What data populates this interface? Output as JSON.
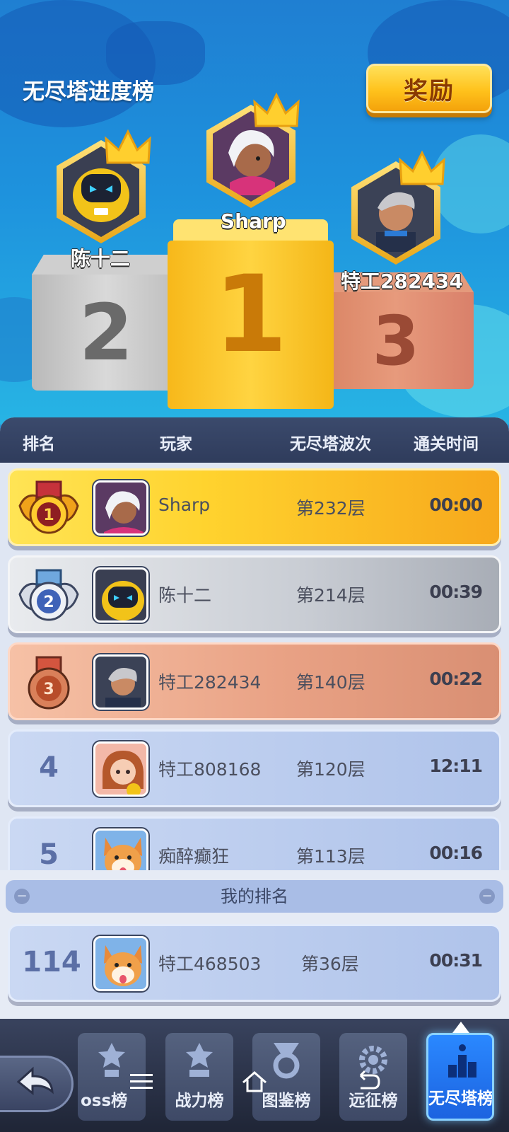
{
  "header": {
    "title": "无尽塔进度榜",
    "reward_label": "奖励"
  },
  "podium": [
    {
      "place": "2",
      "name": "陈十二"
    },
    {
      "place": "1",
      "name": "Sharp"
    },
    {
      "place": "3",
      "name": "特工282434"
    }
  ],
  "table": {
    "columns": [
      "排名",
      "玩家",
      "无尽塔波次",
      "通关时间"
    ],
    "rows": [
      {
        "rank": "1",
        "name": "Sharp",
        "wave": "第232层",
        "time": "00:00",
        "style": "gold"
      },
      {
        "rank": "2",
        "name": "陈十二",
        "wave": "第214层",
        "time": "00:39",
        "style": "silver"
      },
      {
        "rank": "3",
        "name": "特工282434",
        "wave": "第140层",
        "time": "00:22",
        "style": "bronze"
      },
      {
        "rank": "4",
        "name": "特工808168",
        "wave": "第120层",
        "time": "12:11",
        "style": "blue"
      },
      {
        "rank": "5",
        "name": "痴醉癫狂",
        "wave": "第113层",
        "time": "00:16",
        "style": "blue"
      }
    ]
  },
  "my_rank": {
    "label": "我的排名",
    "row": {
      "rank": "114",
      "name": "特工468503",
      "wave": "第36层",
      "time": "00:31"
    }
  },
  "tabs": [
    {
      "label": "oss榜",
      "icon": "trophy-icon"
    },
    {
      "label": "战力榜",
      "icon": "trophy-icon"
    },
    {
      "label": "图鉴榜",
      "icon": "medal-icon"
    },
    {
      "label": "远征榜",
      "icon": "gear-icon"
    },
    {
      "label": "无尽塔榜",
      "icon": "podium-icon",
      "active": true
    }
  ],
  "colors": {
    "gold": "#ffd32e",
    "silver": "#c9cdd4",
    "bronze": "#e9a285",
    "blue_row": "#afc3ea",
    "header_bg": "#2f3c5c",
    "active_tab": "#1c63e0"
  }
}
